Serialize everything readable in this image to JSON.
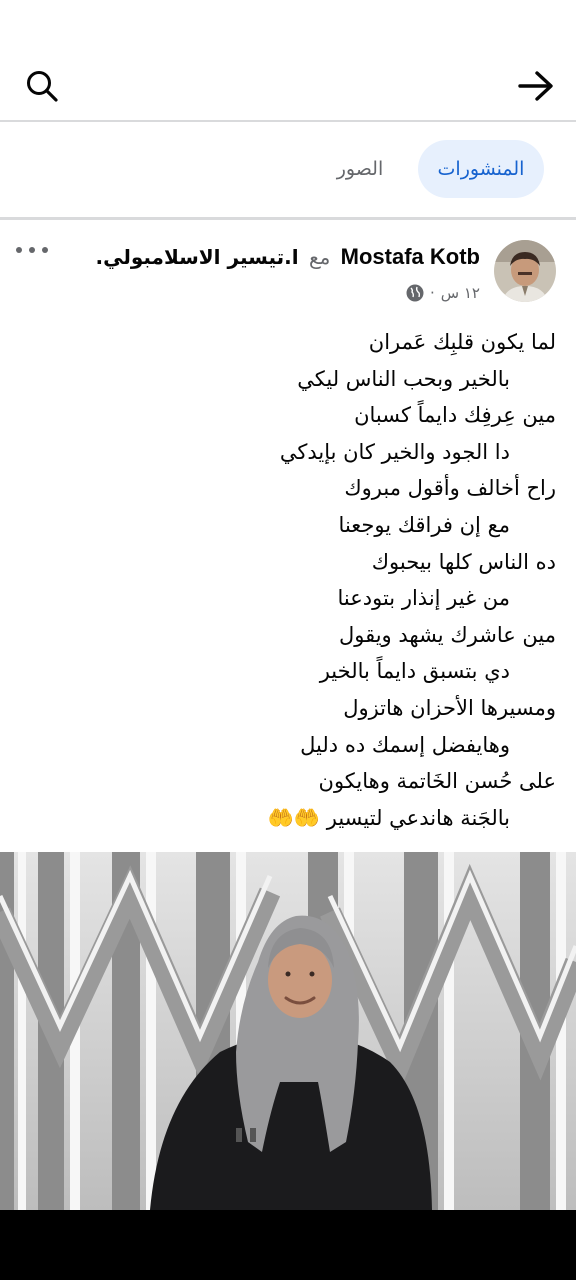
{
  "header": {
    "search_icon": "search-icon",
    "back_icon": "arrow-right-icon"
  },
  "tabs": {
    "active": {
      "label": "المنشورات"
    },
    "photos": {
      "label": "الصور"
    }
  },
  "post": {
    "author": "Mostafa Kotb",
    "with_word": "مع",
    "tagged": "ا.تيسير الاسلامبولي",
    "tagged_suffix": ".",
    "time": "١٢ س",
    "separator": "·",
    "privacy_icon": "globe-icon",
    "lines": [
      "لما يكون قلبِك عَمران",
      "بالخير وبحب الناس ليكي",
      "مين عِرفِك دايماً كسبان",
      "دا الجود والخير كان بإيدكي",
      "راح أخالف وأقول مبروك",
      "مع إن فراقك يوجعنا",
      "ده الناس كلها بيحبوك",
      "من غير إنذار بتودعنا",
      "مين عاشرك يشهد ويقول",
      "دي بتسبق دايماً بالخير",
      "ومسيرها الأحزان هاتزول",
      "وهايفضل إسمك ده دليل",
      "على حُسن الخَاتمة وهايكون",
      "بالجَنة هاندعي لتيسير 🤲🤲"
    ]
  },
  "colors": {
    "accent": "#1763cf",
    "tab_active_bg": "#e7f0fd",
    "muted": "#65676b"
  }
}
